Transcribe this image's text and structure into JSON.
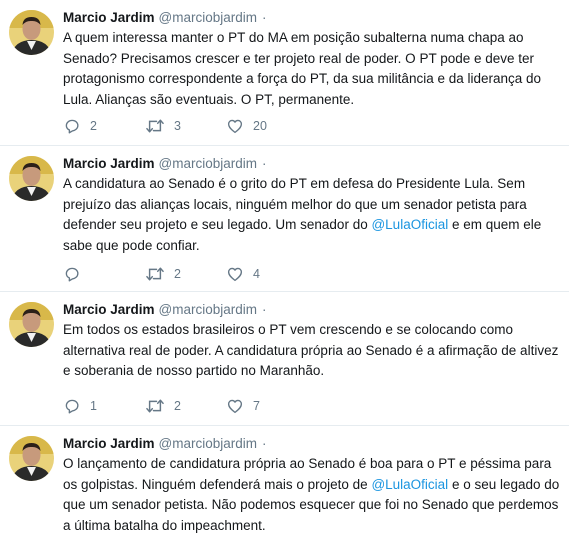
{
  "tweets": [
    {
      "name": "Marcio Jardim",
      "handle": "@marciobjardim",
      "dot": "·",
      "text_parts": [
        "A quem interessa manter o PT do MA em posição subalterna numa chapa ao Senado? Precisamos crescer e ter projeto real de poder. O PT pode e deve ter protagonismo correspondente a força do PT, da sua militância e da liderança do Lula. Alianças são eventuais. O PT, permanente."
      ],
      "replies": "2",
      "retweets": "3",
      "likes": "20"
    },
    {
      "name": "Marcio Jardim",
      "handle": "@marciobjardim",
      "dot": "·",
      "text_parts": [
        "A candidatura ao Senado é o grito do PT em defesa do Presidente Lula. Sem prejuízo das alianças locais, ninguém melhor do que um senador petista para defender seu projeto e seu legado. Um senador do ",
        "@LulaOficial",
        " e em quem ele sabe que pode confiar."
      ],
      "replies": "",
      "retweets": "2",
      "likes": "4"
    },
    {
      "name": "Marcio Jardim",
      "handle": "@marciobjardim",
      "dot": "·",
      "text_parts": [
        "Em todos os estados brasileiros o PT vem crescendo e se colocando como alternativa real de poder. A candidatura própria ao Senado é a afirmação de altivez e soberania de nosso partido no Maranhão."
      ],
      "replies": "1",
      "retweets": "2",
      "likes": "7"
    },
    {
      "name": "Marcio Jardim",
      "handle": "@marciobjardim",
      "dot": "·",
      "text_parts": [
        "O lançamento de candidatura própria ao Senado é boa para o PT e péssima para os golpistas. Ninguém defenderá mais o projeto de ",
        "@LulaOficial",
        " e o seu legado do que um senador petista. Não podemos esquecer que foi no Senado que perdemos a última batalha do impeachment."
      ],
      "replies": "",
      "retweets": "",
      "likes": ""
    }
  ],
  "colors": {
    "text": "#14171a",
    "secondary": "#657786",
    "link": "#1b95e0",
    "divider": "#e6ecf0"
  },
  "icons": {
    "reply": "reply-icon",
    "retweet": "retweet-icon",
    "like": "heart-icon"
  }
}
